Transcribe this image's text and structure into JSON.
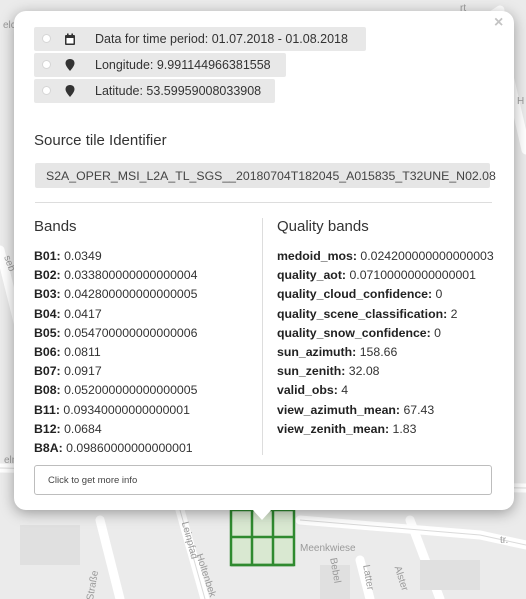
{
  "popup": {
    "close_glyph": "×",
    "info_rows": [
      {
        "icon": "calendar-icon",
        "text": "Data for time period: 01.07.2018 - 01.08.2018"
      },
      {
        "icon": "map-marker-icon",
        "text": "Longitude: 9.991144966381558"
      },
      {
        "icon": "map-marker-icon",
        "text": "Latitude: 53.59959008033908"
      }
    ],
    "source_tile": {
      "title": "Source tile Identifier",
      "value": "S2A_OPER_MSI_L2A_TL_SGS__20180704T182045_A015835_T32UNE_N02.08"
    },
    "bands": {
      "title": "Bands",
      "items": [
        {
          "key": "B01:",
          "value": "0.0349"
        },
        {
          "key": "B02:",
          "value": "0.033800000000000004"
        },
        {
          "key": "B03:",
          "value": "0.042800000000000005"
        },
        {
          "key": "B04:",
          "value": "0.0417"
        },
        {
          "key": "B05:",
          "value": "0.054700000000000006"
        },
        {
          "key": "B06:",
          "value": "0.0811"
        },
        {
          "key": "B07:",
          "value": "0.0917"
        },
        {
          "key": "B08:",
          "value": "0.052000000000000005"
        },
        {
          "key": "B11:",
          "value": "0.09340000000000001"
        },
        {
          "key": "B12:",
          "value": "0.0684"
        },
        {
          "key": "B8A:",
          "value": "0.09860000000000001"
        }
      ]
    },
    "quality_bands": {
      "title": "Quality bands",
      "items": [
        {
          "key": "medoid_mos:",
          "value": "0.024200000000000003"
        },
        {
          "key": "quality_aot:",
          "value": "0.07100000000000001"
        },
        {
          "key": "quality_cloud_confidence:",
          "value": "0"
        },
        {
          "key": "quality_scene_classification:",
          "value": "2"
        },
        {
          "key": "quality_snow_confidence:",
          "value": "0"
        },
        {
          "key": "sun_azimuth:",
          "value": "158.66"
        },
        {
          "key": "sun_zenith:",
          "value": "32.08"
        },
        {
          "key": "valid_obs:",
          "value": "4"
        },
        {
          "key": "view_azimuth_mean:",
          "value": "67.43"
        },
        {
          "key": "view_zenith_mean:",
          "value": "1.83"
        }
      ]
    },
    "more_info_label": "Click to get more info"
  },
  "map": {
    "labels": [
      "Meenkwiese",
      "Bebel",
      "Latter",
      "Alster",
      "tr.",
      "Straße",
      "Leinpfad",
      "Holtenbek",
      "seb",
      "eln",
      "H",
      "elc",
      "rt"
    ],
    "grid_color": "#2f8a2f"
  }
}
